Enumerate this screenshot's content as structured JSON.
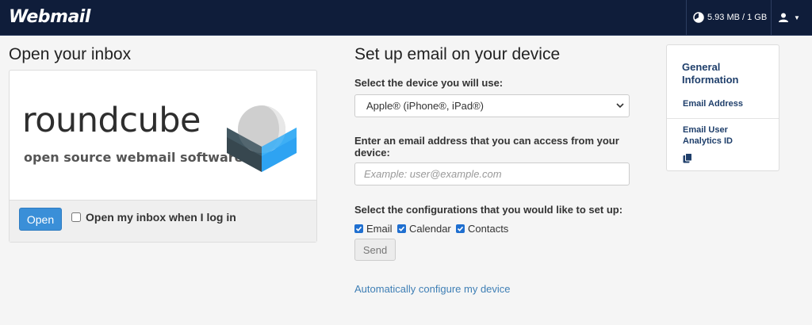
{
  "header": {
    "logo": "Webmail",
    "quota": "5.93 MB / 1 GB",
    "quota_icon": "pie-chart-icon",
    "user_icon": "user-icon"
  },
  "inbox": {
    "title": "Open your inbox",
    "logo_word": "roundcube",
    "logo_tagline": "open source webmail software",
    "open_button": "Open",
    "open_on_login_label": "Open my inbox when I log in",
    "open_on_login_checked": false
  },
  "setup": {
    "title": "Set up email on your device",
    "device_label": "Select the device you will use:",
    "device_selected": "Apple® (iPhone®, iPad®)",
    "email_label": "Enter an email address that you can access from your device:",
    "email_value": "",
    "email_placeholder": "Example: user@example.com",
    "config_label": "Select the configurations that you would like to set up:",
    "configs": [
      {
        "label": "Email",
        "checked": true
      },
      {
        "label": "Calendar",
        "checked": true
      },
      {
        "label": "Contacts",
        "checked": true
      }
    ],
    "send_button": "Send",
    "auto_link": "Automatically configure my device"
  },
  "info": {
    "title": "General Information",
    "email_address_label": "Email Address",
    "analytics_label": "Email User Analytics ID",
    "copy_icon": "copy-icon"
  },
  "colors": {
    "topbar": "#0f1d3a",
    "primary": "#3a8fd8",
    "link": "#3f7fb5",
    "checkbox": "#1f6fd0"
  }
}
